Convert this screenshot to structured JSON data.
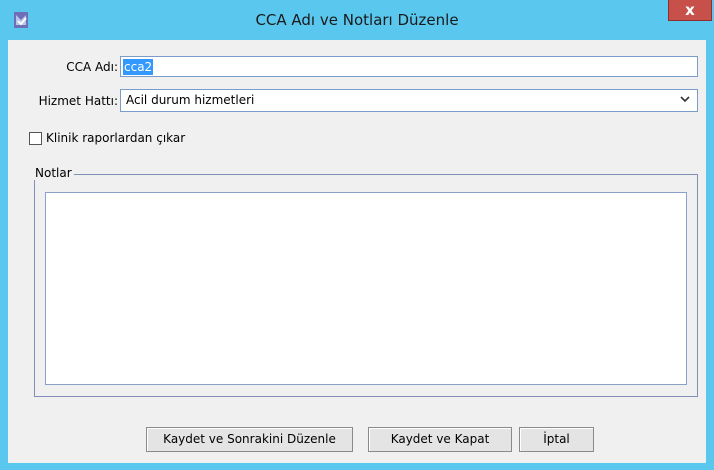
{
  "window": {
    "title": "CCA Adı ve Notları Düzenle",
    "close_label": "x",
    "accent_color": "#5ac8ee",
    "close_color": "#c7504b"
  },
  "form": {
    "cca_label": "CCA Adı:",
    "cca_value": "cca2",
    "service_label": "Hizmet Hattı:",
    "service_value": "Acil durum hizmetleri",
    "exclude_label": "Klinik raporlardan çıkar",
    "exclude_checked": false,
    "notes_legend": "Notlar",
    "notes_value": ""
  },
  "buttons": {
    "save_next": "Kaydet ve Sonrakini Düzenle",
    "save_close": "Kaydet ve Kapat",
    "cancel": "İptal"
  },
  "icons": {
    "app": "app-logo-icon",
    "dropdown": "chevron-down-icon"
  }
}
